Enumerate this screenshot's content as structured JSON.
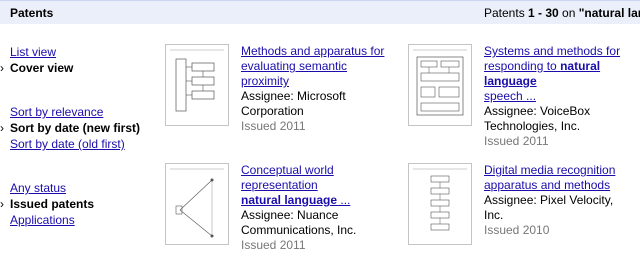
{
  "header": {
    "title": "Patents",
    "results_prefix": "Patents ",
    "results_range": "1 - 30",
    "results_mid": " on ",
    "results_query": "\"natural langua"
  },
  "sidebar": {
    "view": [
      {
        "label": "List view",
        "selected": false
      },
      {
        "label": "Cover view",
        "selected": true
      }
    ],
    "sort": [
      {
        "label": "Sort by relevance",
        "selected": false
      },
      {
        "label": "Sort by date (new first)",
        "selected": true
      },
      {
        "label": "Sort by date (old first)",
        "selected": false
      }
    ],
    "status": [
      {
        "label": "Any status",
        "selected": false
      },
      {
        "label": "Issued patents",
        "selected": true
      },
      {
        "label": "Applications",
        "selected": false
      }
    ]
  },
  "results": [
    {
      "title_line1": "Methods and apparatus for",
      "title_line2": "evaluating semantic proximity",
      "assignee_line1": "Assignee: Microsoft Corporation",
      "assignee_line2": "",
      "issued": "Issued 2011"
    },
    {
      "title_line1": "Systems and methods for",
      "title_line2_pre": "responding to ",
      "title_line2_hl": "natural language",
      "title_line3": "speech ...",
      "assignee_line1": "Assignee: VoiceBox",
      "assignee_line2": "Technologies, Inc.",
      "issued": "Issued 2011"
    },
    {
      "title_line1": "Conceptual world representation",
      "title_line2_hl": "natural language",
      "title_line2_post": " ...",
      "assignee_line1": "Assignee: Nuance",
      "assignee_line2": "Communications, Inc.",
      "issued": "Issued 2011"
    },
    {
      "title_line1": "Digital media recognition",
      "title_line2": "apparatus and methods",
      "assignee_line1": "Assignee: Pixel Velocity, Inc.",
      "assignee_line2": "",
      "issued": "Issued 2010"
    }
  ]
}
